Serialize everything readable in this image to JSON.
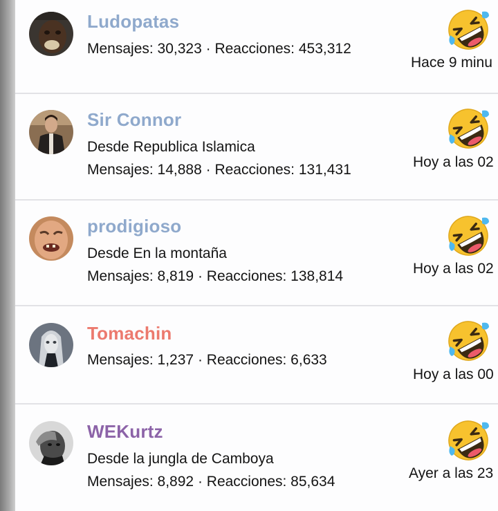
{
  "members": [
    {
      "name": "Ludopatas",
      "name_color": "#8fa9cc",
      "location": "",
      "mensajes": "Mensajes: 30,323",
      "reacciones": "Reacciones: 453,312",
      "time": "Hace 9 minu",
      "reaction_icon": "rofl-emoji-icon",
      "avatar_icon": "avatar-dark-face"
    },
    {
      "name": "Sir Connor",
      "name_color": "#8fa9cc",
      "location": "Desde Republica Islamica",
      "mensajes": "Mensajes: 14,888",
      "reacciones": "Reacciones: 131,431",
      "time": "Hoy a las 02",
      "reaction_icon": "rofl-emoji-icon",
      "avatar_icon": "avatar-man-jacket"
    },
    {
      "name": "prodigioso",
      "name_color": "#8fa9cc",
      "location": "Desde En la montaña",
      "mensajes": "Mensajes: 8,819",
      "reacciones": "Reacciones: 138,814",
      "time": "Hoy a las 02",
      "reaction_icon": "rofl-emoji-icon",
      "avatar_icon": "avatar-laughing-man"
    },
    {
      "name": "Tomachin",
      "name_color": "#ec7a6e",
      "location": "",
      "mensajes": "Mensajes: 1,237",
      "reacciones": "Reacciones: 6,633",
      "time": "Hoy a las 00",
      "reaction_icon": "rofl-emoji-icon",
      "avatar_icon": "avatar-pale-figure"
    },
    {
      "name": "WEKurtz",
      "name_color": "#8c63a8",
      "location": "Desde la jungla de Camboya",
      "mensajes": "Mensajes: 8,892",
      "reacciones": "Reacciones: 85,634",
      "time": "Ayer a las 23",
      "reaction_icon": "rofl-emoji-icon",
      "avatar_icon": "avatar-bw-hand-head"
    }
  ],
  "separator": " · ",
  "colors": {
    "text": "#141414",
    "divider": "#e2e2e6",
    "panel": "#fdfdfe"
  }
}
